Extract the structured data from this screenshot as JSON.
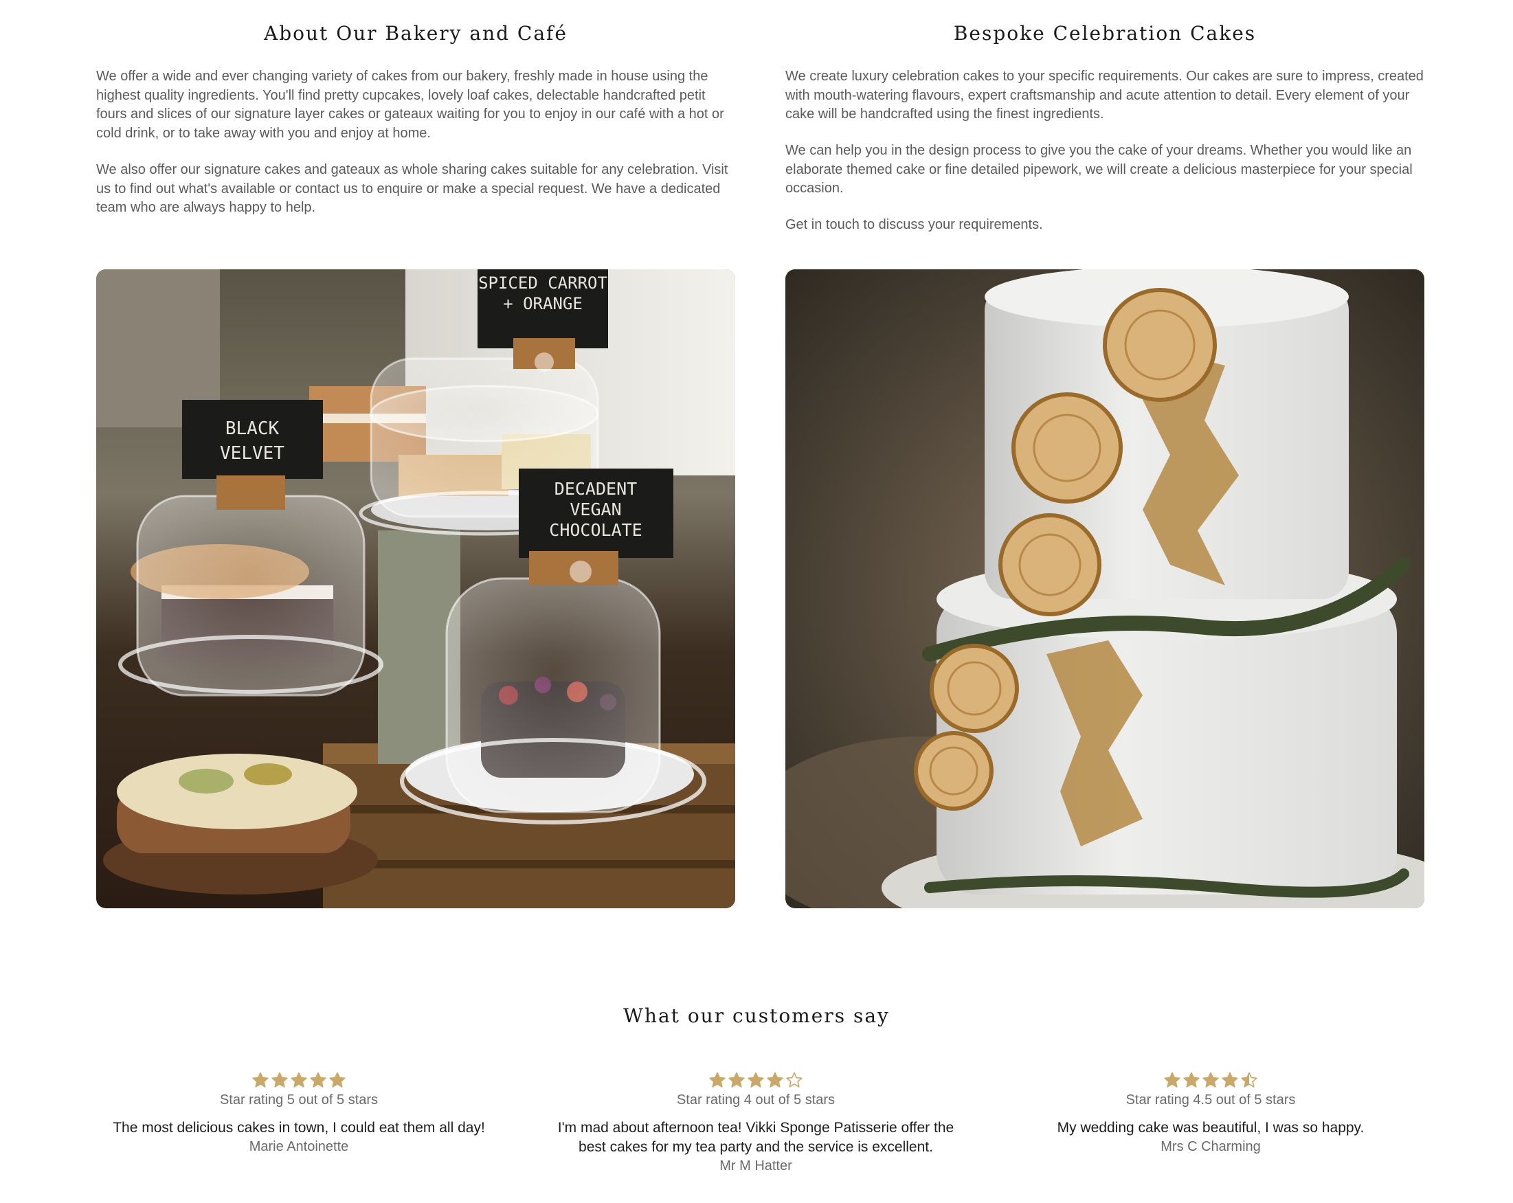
{
  "about": {
    "title": "About Our Bakery and Café",
    "p1": "We offer a wide and ever changing variety of cakes from our bakery, freshly made in house using the highest quality ingredients. You'll find pretty cupcakes, lovely loaf cakes, delectable handcrafted petit fours and slices of our signature layer cakes or gateaux waiting for you to enjoy in our café with a hot or cold drink, or to take away with you and enjoy at home.",
    "p2": "We also offer our signature cakes and gateaux as whole sharing cakes suitable for any celebration. Visit us to find out what's available or contact us to enquire or make a special request. We have a dedicated team who are always happy to help.",
    "signs": [
      "SPICED CARROT",
      "+ ORANGE",
      "BLACK",
      "VELVET",
      "DECADENT",
      "VEGAN",
      "CHOCOLATE"
    ]
  },
  "bespoke": {
    "title": "Bespoke Celebration Cakes",
    "p1": "We create luxury celebration cakes to your specific requirements. Our cakes are sure to impress, created with mouth-watering flavours, expert craftsmanship and acute attention to detail. Every element of your cake will be handcrafted using the finest ingredients.",
    "p2": "We can help you in the design process to give you the cake of your dreams. Whether you would like an elaborate themed cake or fine detailed pipework, we will create a delicious masterpiece for your special occasion.",
    "p3": "Get in touch to discuss your requirements."
  },
  "reviews": {
    "title": "What our customers say",
    "star_color": "#c9a86a",
    "items": [
      {
        "stars": 5,
        "rating_text": "Star rating 5 out of 5 stars",
        "quote": "The most delicious cakes in town, I could eat them all day!",
        "author": "Marie Antoinette"
      },
      {
        "stars": 4,
        "rating_text": "Star rating 4 out of 5 stars",
        "quote": "I'm mad about afternoon tea! Vikki Sponge Patisserie offer the best cakes for my tea party and the service is excellent.",
        "author": "Mr M Hatter"
      },
      {
        "stars": 4.5,
        "rating_text": "Star rating 4.5 out of 5 stars",
        "quote": "My wedding cake was beautiful, I was so happy.",
        "author": "Mrs C Charming"
      }
    ]
  }
}
